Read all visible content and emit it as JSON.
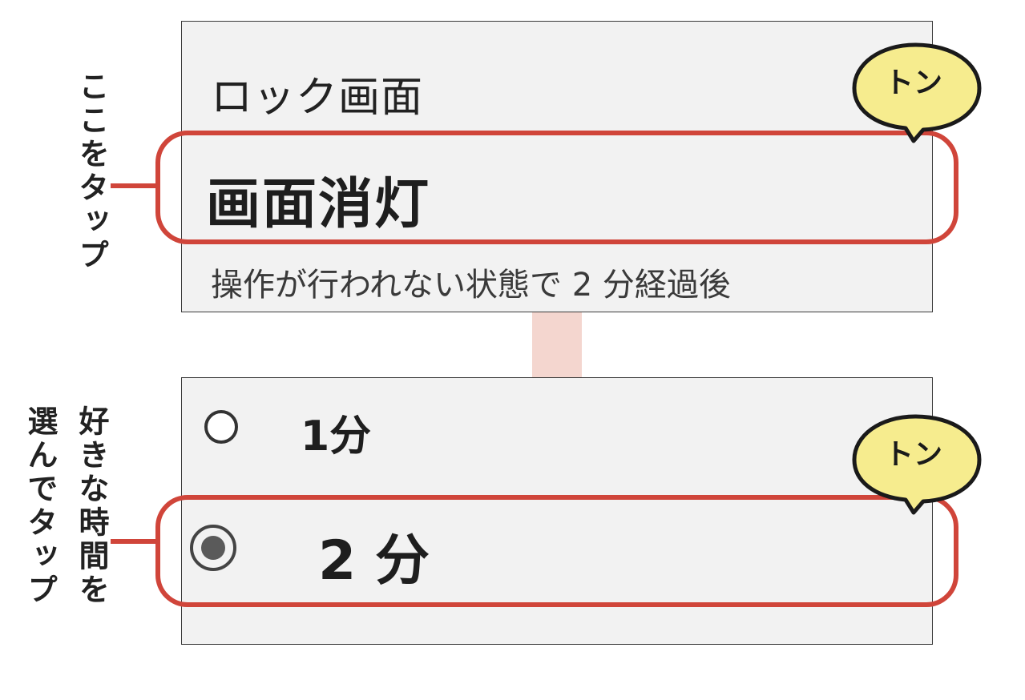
{
  "settings_panel": {
    "section_title": "ロック画面",
    "item_title": "画面消灯",
    "item_subtitle": "操作が行われない状態で 2 分経過後"
  },
  "options_panel": {
    "options": [
      {
        "label": "1分",
        "selected": false
      },
      {
        "label": "2 分",
        "selected": true
      }
    ]
  },
  "annotations": {
    "tap_bubble": "トン",
    "step1_callout": "ここをタップ",
    "step2_callout_line1": "好きな時間を",
    "step2_callout_line2": "選んでタップ"
  },
  "colors": {
    "highlight": "#d0453a",
    "bubble_fill": "#f6ec8e",
    "connector": "#f4d6cf",
    "panel_bg": "#f2f2f2"
  }
}
